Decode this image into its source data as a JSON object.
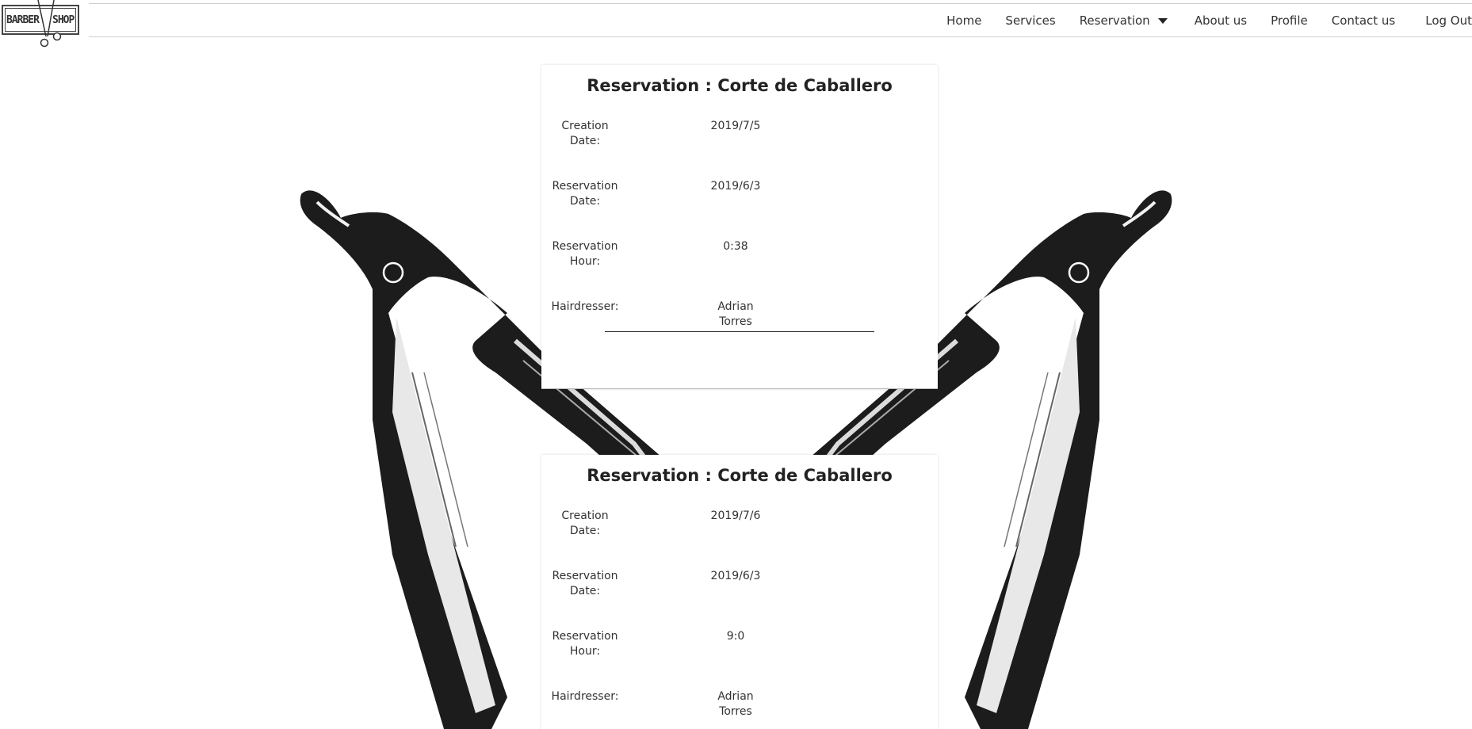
{
  "brand": {
    "logo_text_left": "BARBER",
    "logo_text_right": "SHOP"
  },
  "nav": {
    "home": "Home",
    "services": "Services",
    "reservation": "Reservation",
    "about": "About us",
    "profile": "Profile",
    "contact": "Contact us",
    "logout": "Log Out"
  },
  "reservations": [
    {
      "title": "Reservation : Corte de Caballero",
      "creation_label": "Creation Date:",
      "creation_value": "2019/7/5",
      "date_label": "Reservation Date:",
      "date_value": "2019/6/3",
      "hour_label": "Reservation Hour:",
      "hour_value": "0:38",
      "hairdresser_label": "Hairdresser:",
      "hairdresser_value": "Adrian Torres"
    },
    {
      "title": "Reservation : Corte de Caballero",
      "creation_label": "Creation Date:",
      "creation_value": "2019/7/6",
      "date_label": "Reservation Date:",
      "date_value": "2019/6/3",
      "hour_label": "Reservation Hour:",
      "hour_value": "9:0",
      "hairdresser_label": "Hairdresser:",
      "hairdresser_value": "Adrian Torres"
    }
  ]
}
